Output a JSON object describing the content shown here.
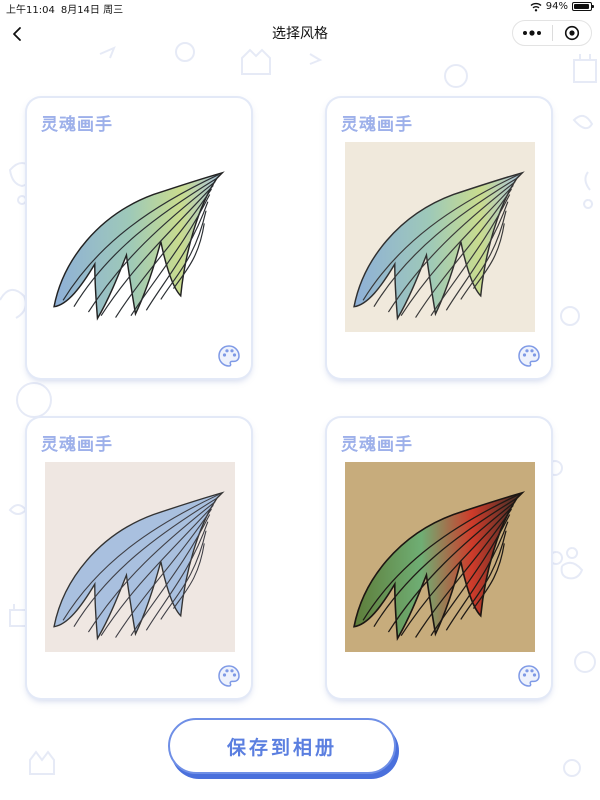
{
  "status_bar": {
    "time": "上午11:04",
    "date": "8月14日 周三",
    "battery": "94%",
    "battery_level": 0.94
  },
  "nav": {
    "title": "选择风格",
    "back_icon": "chevron-left-icon",
    "more_icon": "more-dots-icon",
    "close_icon": "target-circle-icon"
  },
  "cards": [
    {
      "brand": "灵魂画手",
      "style": "plain-white",
      "icon": "palette-icon"
    },
    {
      "brand": "灵魂画手",
      "style": "cream-watercolor",
      "icon": "palette-icon"
    },
    {
      "brand": "灵魂画手",
      "style": "pastel-sketch",
      "icon": "palette-icon"
    },
    {
      "brand": "灵魂画手",
      "style": "warm-oil",
      "icon": "palette-icon"
    }
  ],
  "save_button": {
    "label": "保存到相册"
  },
  "colors": {
    "accent": "#5b7fe0",
    "brand_text": "#9db0ea",
    "card_shadow": "#e3e9f7"
  }
}
